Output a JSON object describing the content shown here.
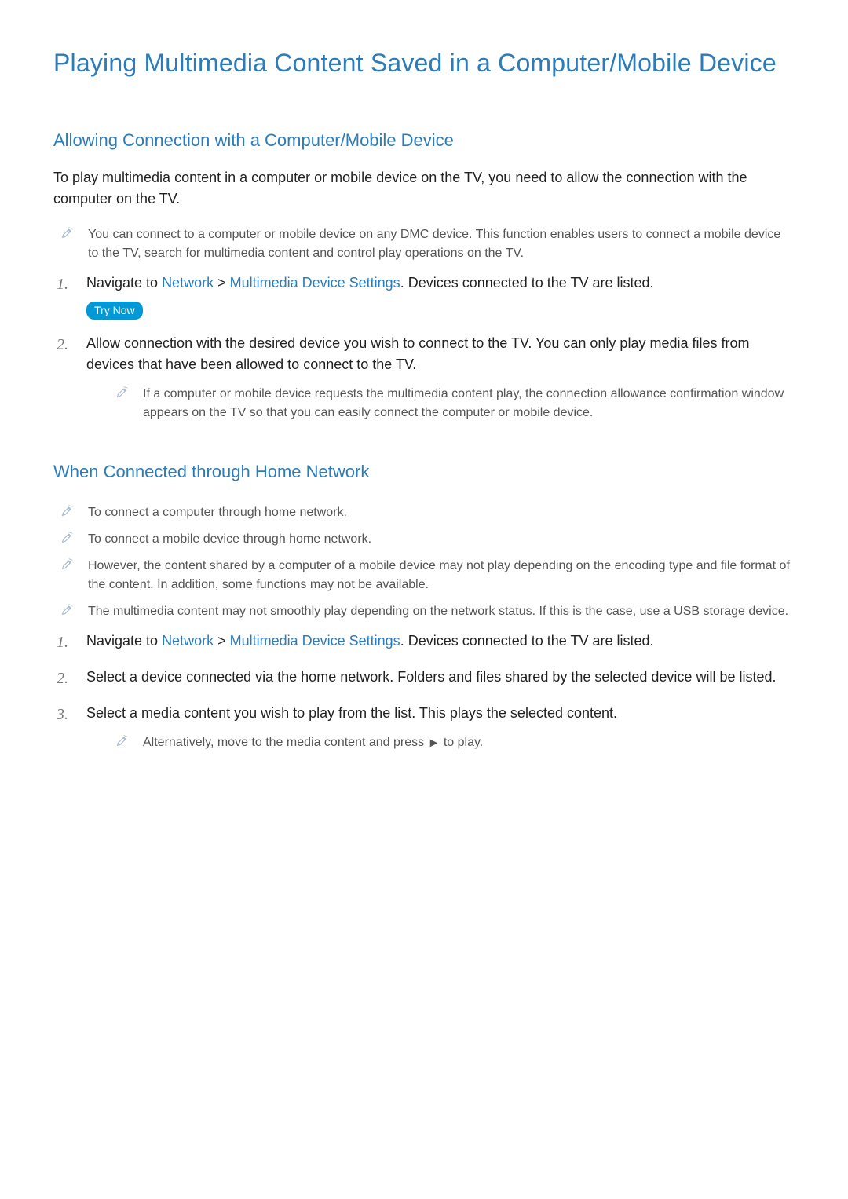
{
  "title": "Playing Multimedia Content Saved in a Computer/Mobile Device",
  "sectionA": {
    "heading": "Allowing Connection with a Computer/Mobile Device",
    "intro": "To play multimedia content in a computer or mobile device on the TV, you need to allow the connection with the computer on the TV.",
    "note1": "You can connect to a computer or mobile device on any DMC device. This function enables users to connect a mobile device to the TV, search for multimedia content and control play operations on the TV.",
    "step1_pre": "Navigate to ",
    "step1_link1": "Network",
    "step1_sep": " > ",
    "step1_link2": "Multimedia Device Settings",
    "step1_post": ". Devices connected to the TV are listed.",
    "try_now": "Try Now",
    "step2": "Allow connection with the desired device you wish to connect to the TV. You can only play media files from devices that have been allowed to connect to the TV.",
    "step2_note": "If a computer or mobile device requests the multimedia content play, the connection allowance confirmation window appears on the TV so that you can easily connect the computer or mobile device."
  },
  "sectionB": {
    "heading": "When Connected through Home Network",
    "note1": "To connect a computer through home network.",
    "note2": "To connect a mobile device through home network.",
    "note3": "However, the content shared by a computer of a mobile device may not play depending on the encoding type and file format of the content. In addition, some functions may not be available.",
    "note4": "The multimedia content may not smoothly play depending on the network status. If this is the case, use a USB storage device.",
    "step1_pre": "Navigate to ",
    "step1_link1": "Network",
    "step1_sep": " > ",
    "step1_link2": "Multimedia Device Settings",
    "step1_post": ". Devices connected to the TV are listed.",
    "step2": "Select a device connected via the home network. Folders and files shared by the selected device will be listed.",
    "step3": "Select a media content you wish to play from the list. This plays the selected content.",
    "step3_note_pre": "Alternatively, move to the media content and press ",
    "step3_note_glyph": "►",
    "step3_note_post": " to play."
  },
  "numerals": {
    "n1": "1.",
    "n2": "2.",
    "n3": "3."
  }
}
